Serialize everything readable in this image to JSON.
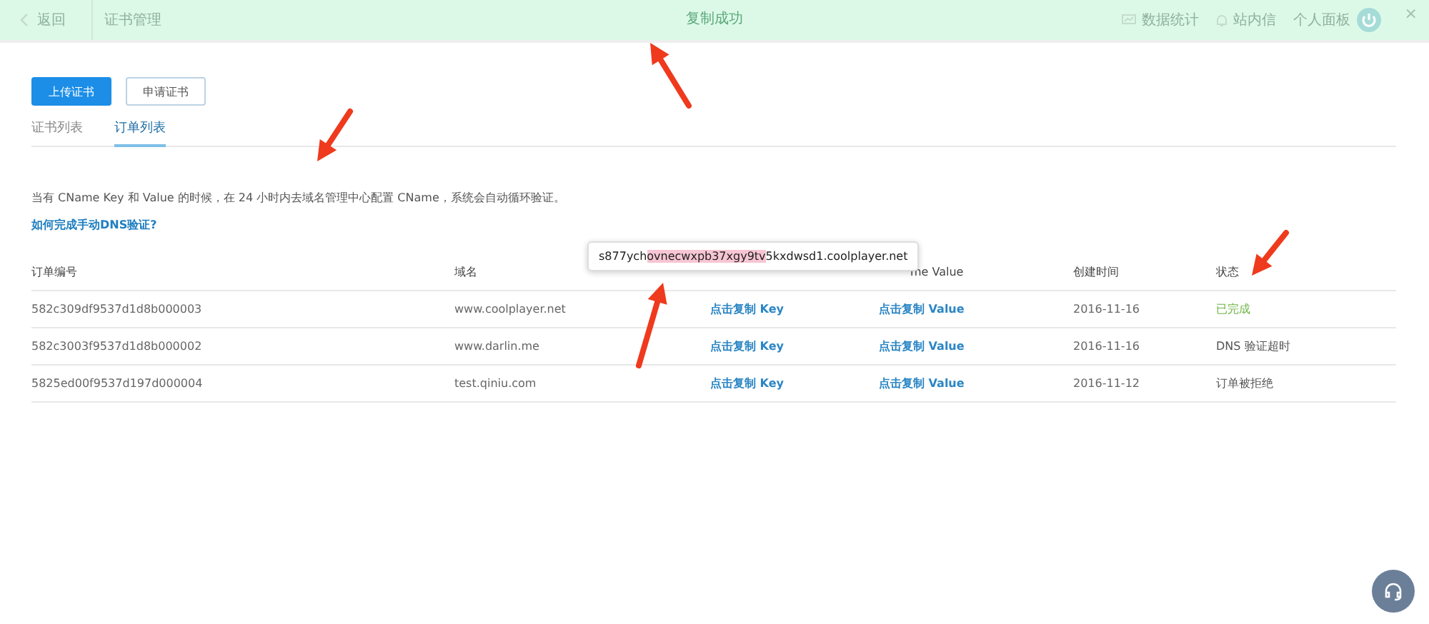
{
  "header": {
    "back": "返回",
    "title": "证书管理",
    "nav": [
      {
        "kind": "stats",
        "label": "数据统计"
      },
      {
        "kind": "bell",
        "label": "站内信"
      },
      {
        "kind": "user",
        "label": "个人面板"
      }
    ]
  },
  "toast": {
    "message": "复制成功"
  },
  "buttons": [
    {
      "label": "上传证书",
      "kind": "primary"
    },
    {
      "label": "申请证书",
      "kind": "default"
    }
  ],
  "tabs": [
    {
      "label": "证书列表",
      "selected": false
    },
    {
      "label": "订单列表",
      "selected": true
    }
  ],
  "notice": "当有 CName Key 和 Value 的时候，在 24 小时内去域名管理中心配置 CName，系统会自动循环验证。",
  "help_link": "如何完成手动DNS验证?",
  "table": {
    "columns": [
      "订单编号",
      "域名",
      "",
      "me Value",
      "创建时间",
      "状态"
    ],
    "rows": [
      {
        "order": "582c309df9537d1d8b000003",
        "domain": "www.coolplayer.net",
        "key": "点击复制 Key",
        "value": "点击复制 Value",
        "created": "2016-11-16",
        "status": "已完成",
        "color": "#6cb644"
      },
      {
        "order": "582c3003f9537d1d8b000002",
        "domain": "www.darlin.me",
        "key": "点击复制 Key",
        "value": "点击复制 Value",
        "created": "2016-11-16",
        "status": "DNS 验证超时",
        "color": "#555555"
      },
      {
        "order": "5825ed00f9537d197d000004",
        "domain": "test.qiniu.com",
        "key": "点击复制 Key",
        "value": "点击复制 Value",
        "created": "2016-11-12",
        "status": "订单被拒绝",
        "color": "#555555"
      }
    ]
  },
  "tooltip": {
    "before": "s877ych",
    "selected_text": "ovnecwxpb37xgy9tv",
    "after": "5kxdwsd1.coolplayer.net"
  },
  "close": "×"
}
